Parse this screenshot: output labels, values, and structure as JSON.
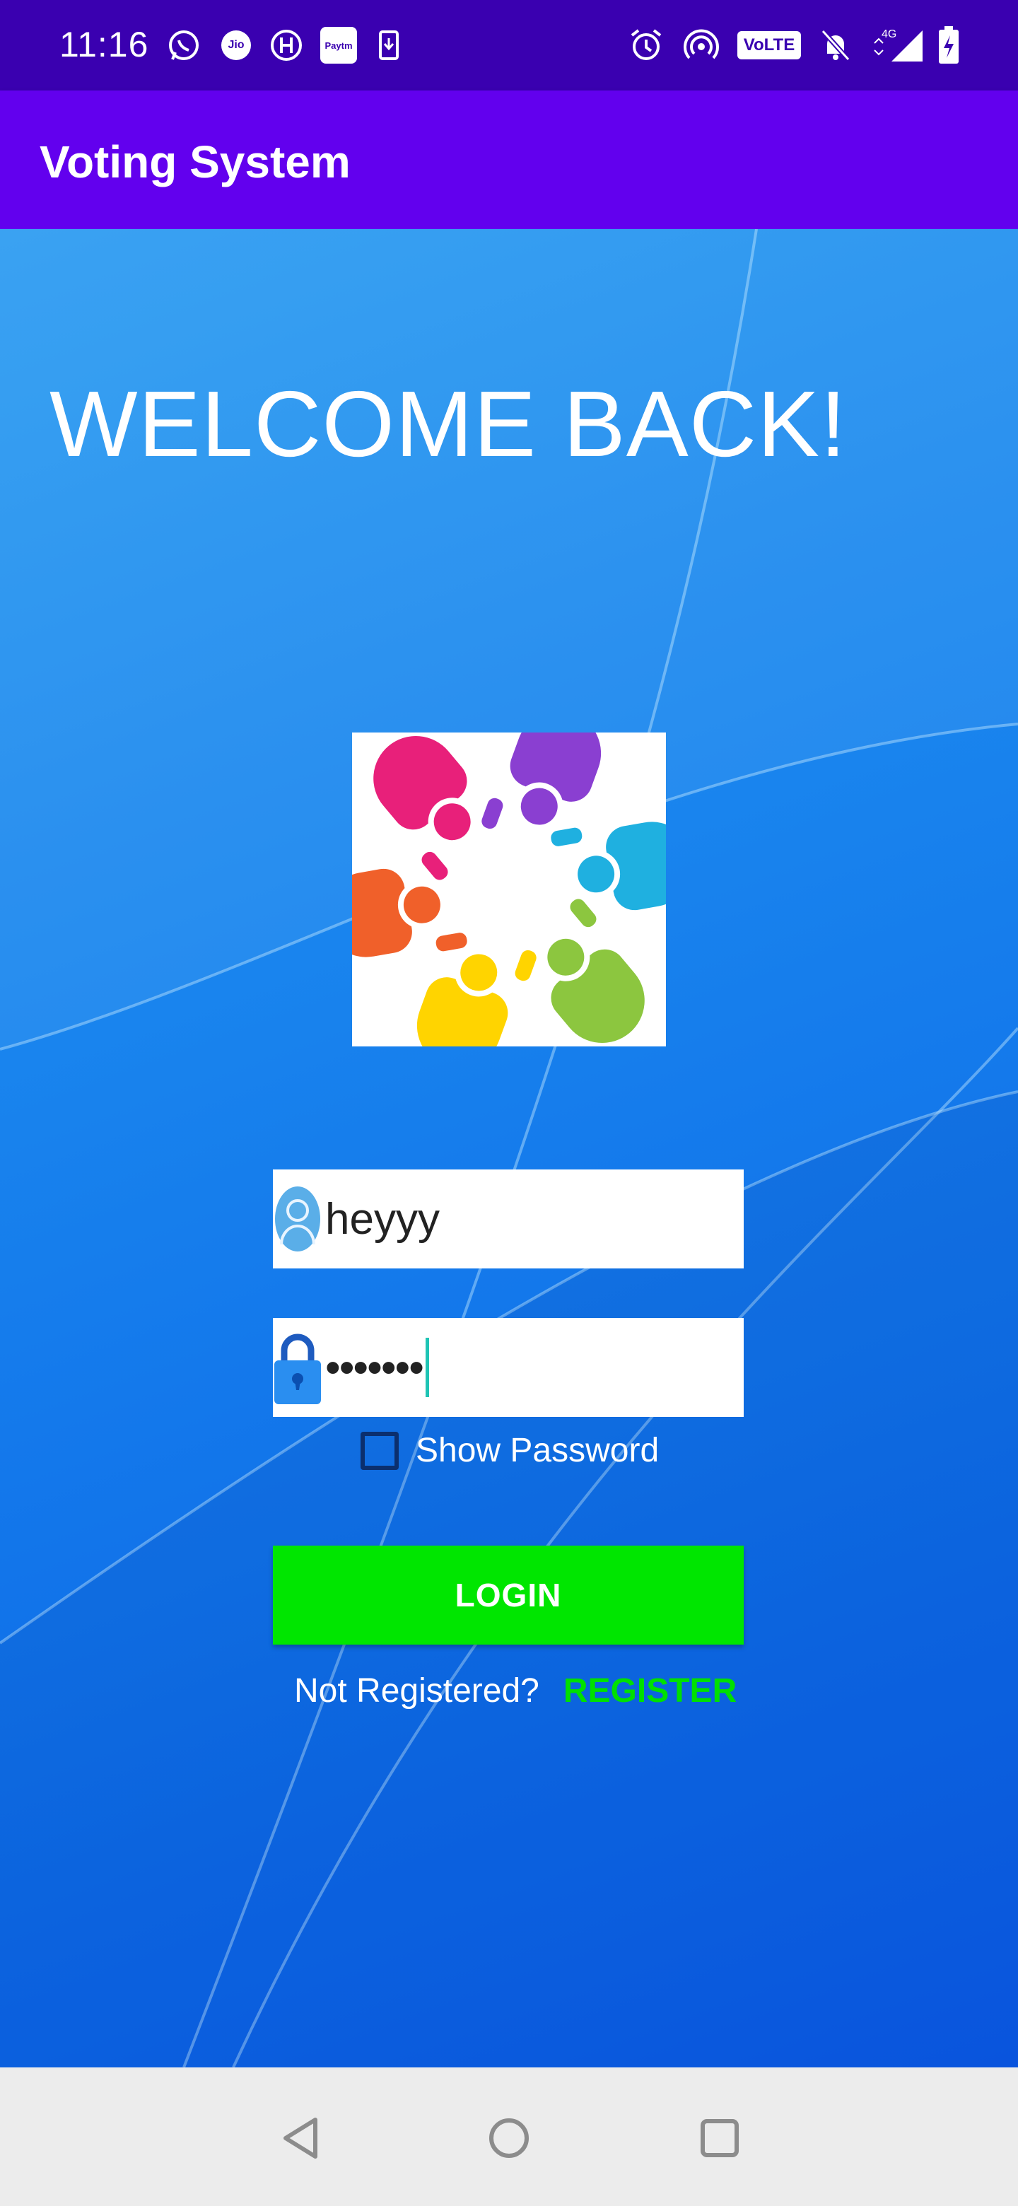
{
  "status_bar": {
    "time": "11:16",
    "left_icons": [
      "whatsapp-icon",
      "jio-icon",
      "h-app-icon",
      "paytm-icon",
      "download-icon"
    ],
    "right_icons": [
      "alarm-icon",
      "hotspot-icon",
      "volte-icon",
      "bell-off-icon",
      "signal-4g-icon",
      "battery-charging-icon"
    ],
    "volte_label": "VoLTE",
    "network_label": "4G",
    "paytm_label": "Paytm",
    "jio_label": "Jio"
  },
  "app_bar": {
    "title": "Voting System"
  },
  "main": {
    "heading": "WELCOME BACK!",
    "logo_icon": "people-circle-logo",
    "username": {
      "value": "heyyy",
      "icon": "user-avatar-icon"
    },
    "password": {
      "value": "•••••••",
      "icon": "lock-icon"
    },
    "show_password": {
      "label": "Show Password",
      "checked": false
    },
    "login_label": "LOGIN",
    "not_registered_label": "Not Registered?",
    "register_label": "REGISTER"
  },
  "nav_bar": {
    "icons": [
      "back-icon",
      "home-icon",
      "recents-icon"
    ]
  },
  "colors": {
    "status_bar": "#3a00b0",
    "app_bar": "#6200ee",
    "login_button": "#00e600",
    "register_link": "#00e000",
    "background": "#1a86ee"
  }
}
